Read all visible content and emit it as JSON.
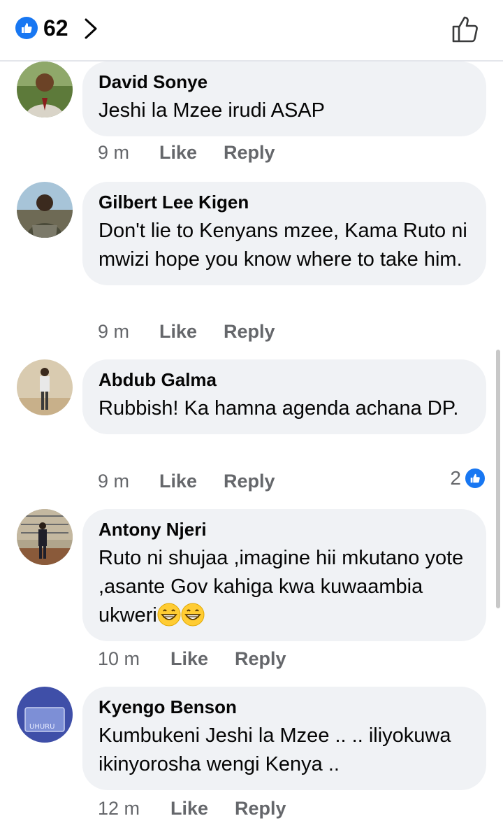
{
  "header": {
    "reaction_count": "62",
    "icons": [
      "like-badge-icon",
      "chevron-right-icon",
      "thumbs-up-outline-icon"
    ]
  },
  "comments": [
    {
      "author": "David Sonye",
      "text": "Jeshi la Mzee irudi ASAP",
      "time": "9 m",
      "like_label": "Like",
      "reply_label": "Reply"
    },
    {
      "author": "Gilbert Lee Kigen",
      "text": "Don't lie to Kenyans mzee, Kama Ruto ni mwizi hope you know where to take him.",
      "time": "9 m",
      "like_label": "Like",
      "reply_label": "Reply"
    },
    {
      "author": "Abdub Galma",
      "text": "Rubbish! Ka hamna agenda achana DP.",
      "time": "9 m",
      "like_label": "Like",
      "reply_label": "Reply",
      "reaction_count": "2"
    },
    {
      "author": "Antony Njeri",
      "text": "Ruto ni shujaa ,imagine hii mkutano yote  ,asante Gov kahiga kwa kuwaambia ukweri",
      "emojis": [
        "grinning-face-icon",
        "grinning-face-icon"
      ],
      "time": "10 m",
      "like_label": "Like",
      "reply_label": "Reply"
    },
    {
      "author": "Kyengo Benson",
      "text": "Kumbukeni Jeshi la Mzee .. .. iliyokuwa ikinyorosha wengi Kenya ..",
      "time": "12 m",
      "like_label": "Like",
      "reply_label": "Reply"
    }
  ],
  "colors": {
    "accent": "#1877f2",
    "bubble": "#f0f2f5",
    "meta_text": "#65676b"
  }
}
